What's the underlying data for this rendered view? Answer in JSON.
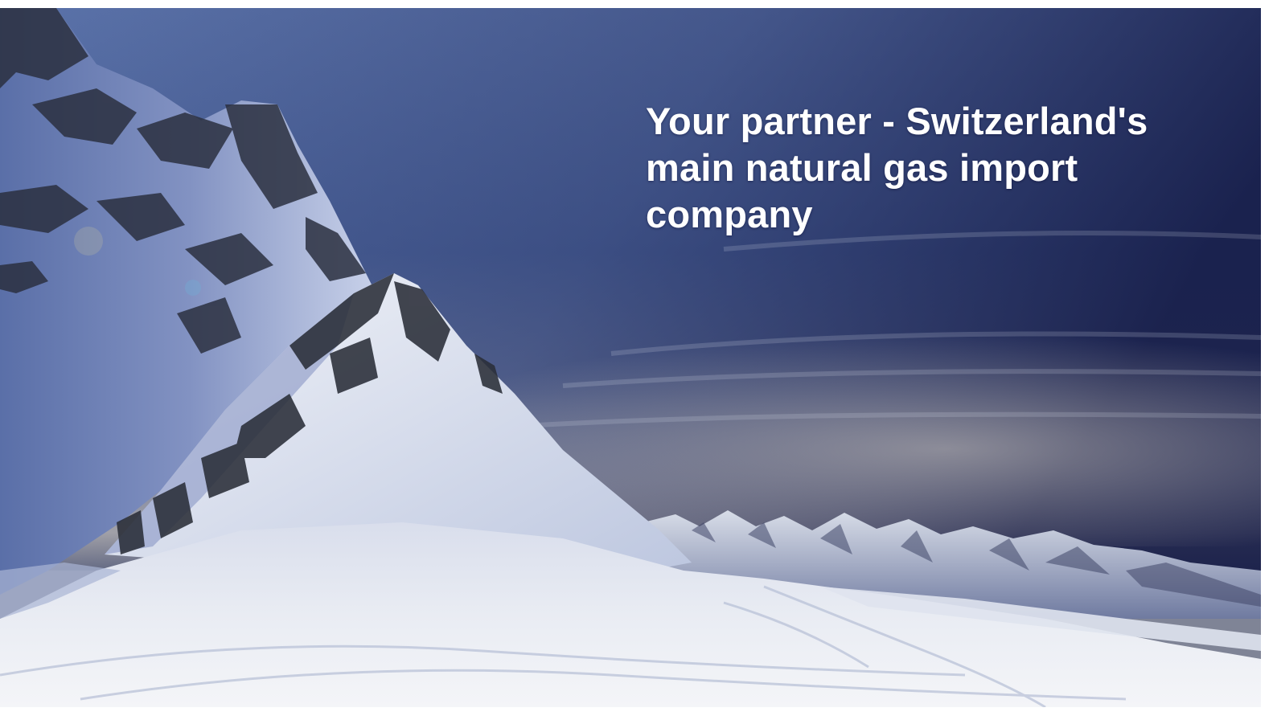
{
  "headline": {
    "lines": [
      "Your partner - Switzerland's",
      "main natural gas import",
      "company"
    ]
  },
  "scene": {
    "subject": "snow-covered-alpine-peak",
    "colors": {
      "sky_top": "#1b2456",
      "sky_mid": "#4a5f94",
      "horizon_haze": "#c4c3c0",
      "snow": "#eef1f7",
      "snow_shadow": "#8b98bf",
      "rock": "#2a2e38",
      "text": "#ffffff"
    }
  }
}
